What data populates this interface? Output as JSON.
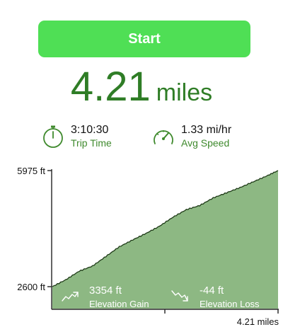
{
  "start_button": {
    "label": "Start"
  },
  "distance": {
    "value": "4.21",
    "unit": "miles"
  },
  "stats": {
    "trip_time": {
      "value": "3:10:30",
      "label": "Trip Time",
      "icon": "stopwatch-icon"
    },
    "avg_speed": {
      "value": "1.33 mi/hr",
      "label": "Avg Speed",
      "icon": "speedometer-icon"
    }
  },
  "elevation": {
    "gain": {
      "value": "3354 ft",
      "label": "Elevation Gain",
      "icon": "trend-up-icon"
    },
    "loss": {
      "value": "-44 ft",
      "label": "Elevation Loss",
      "icon": "trend-down-icon"
    }
  },
  "colors": {
    "accent": "#4fdf55",
    "text_green": "#2f7d26",
    "fill": "#8db883",
    "line": "#1e3a17"
  },
  "chart_data": {
    "type": "area",
    "x": [
      0,
      0.25,
      0.5,
      0.75,
      1.0,
      1.25,
      1.5,
      1.75,
      2.0,
      2.25,
      2.5,
      2.75,
      3.0,
      3.25,
      3.5,
      3.75,
      4.0,
      4.21
    ],
    "values": [
      2600,
      2800,
      3050,
      3200,
      3480,
      3760,
      3960,
      4150,
      4360,
      4620,
      4840,
      4960,
      5180,
      5330,
      5480,
      5650,
      5820,
      5975
    ],
    "y_ticks": [
      "5975 ft",
      "2600 ft"
    ],
    "x_ticks": [
      "4.21 miles"
    ],
    "ylim": [
      2600,
      5975
    ],
    "xlim": [
      0,
      4.21
    ],
    "grid": false
  }
}
